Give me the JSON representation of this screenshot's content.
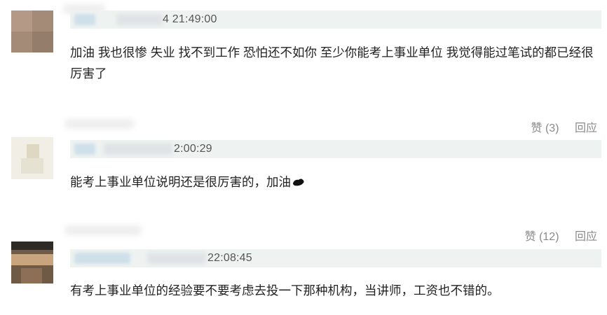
{
  "comments": [
    {
      "timestamp": "4 21:49:00",
      "text_line1": "加油 我也很惨 失业 找不到工作 恐怕还不如你 至少你能考上事业单位 我觉得能过笔试的都已经很",
      "text_line2": "厉害了",
      "likes_label": "赞 (3)",
      "reply_label": "回应",
      "avatar_icon": "user-avatar-icon"
    },
    {
      "timestamp": "2:00:29",
      "text": "能考上事业单位说明还是很厉害的，加油",
      "emoji_icon": "flexed-biceps-icon",
      "likes_label": "赞 (12)",
      "reply_label": "回应",
      "avatar_icon": "user-avatar-icon"
    },
    {
      "timestamp": "22:08:45",
      "text": "有考上事业单位的经验要不要考虑去投一下那种机构，当讲师，工资也不错的。",
      "avatar_icon": "user-avatar-icon"
    }
  ],
  "colors": {
    "meta_bar": "#eef3f1",
    "action_text": "#8a8a8a",
    "body_text": "#222222"
  }
}
